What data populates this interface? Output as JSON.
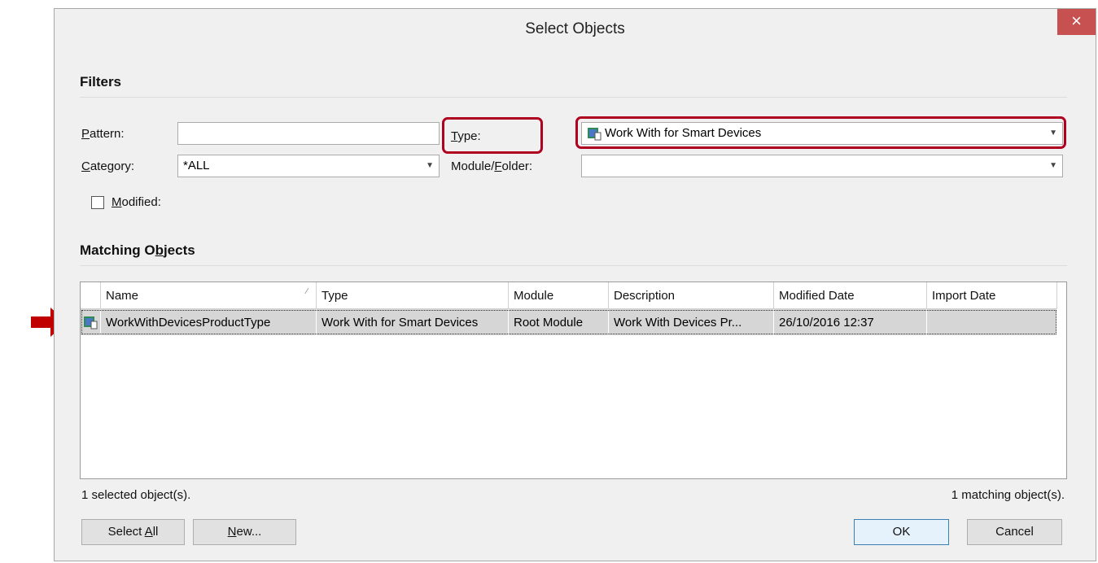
{
  "dialog": {
    "title": "Select Objects",
    "close_glyph": "×"
  },
  "filters": {
    "section_title": "Filters",
    "pattern_label_u": "P",
    "pattern_label_rest": "attern:",
    "pattern_value": "",
    "type_label_u": "T",
    "type_label_rest": "ype:",
    "type_value": "Work With for Smart Devices",
    "category_label_u": "C",
    "category_label_rest": "ategory:",
    "category_value": "*ALL",
    "module_label_a": "Module/",
    "module_label_u": "F",
    "module_label_b": "older:",
    "module_value": "",
    "modified_label_u": "M",
    "modified_label_rest": "odified:",
    "modified_checked": false
  },
  "matching": {
    "title_a": "Matching O",
    "title_u": "b",
    "title_b": "jects",
    "columns": [
      "Name",
      "Type",
      "Module",
      "Description",
      "Modified Date",
      "Import Date"
    ],
    "rows": [
      {
        "name": "WorkWithDevicesProductType",
        "type": "Work With for Smart Devices",
        "module": "Root Module",
        "description": "Work With Devices Pr...",
        "modified": "26/10/2016 12:37",
        "imported": ""
      }
    ]
  },
  "status": {
    "selected": "1 selected object(s).",
    "matching": "1 matching object(s)."
  },
  "buttons": {
    "select_all_a": "Select ",
    "select_all_u": "A",
    "select_all_b": "ll",
    "new_u": "N",
    "new_b": "ew...",
    "ok": "OK",
    "cancel": "Cancel"
  },
  "colors": {
    "highlight": "#b00020",
    "arrow": "#c00000",
    "close": "#c75050"
  },
  "icons": {
    "close": "close-icon",
    "dropdown": "chevron-down-icon",
    "work_with": "work-with-devices-icon",
    "arrow": "red-arrow-icon"
  }
}
